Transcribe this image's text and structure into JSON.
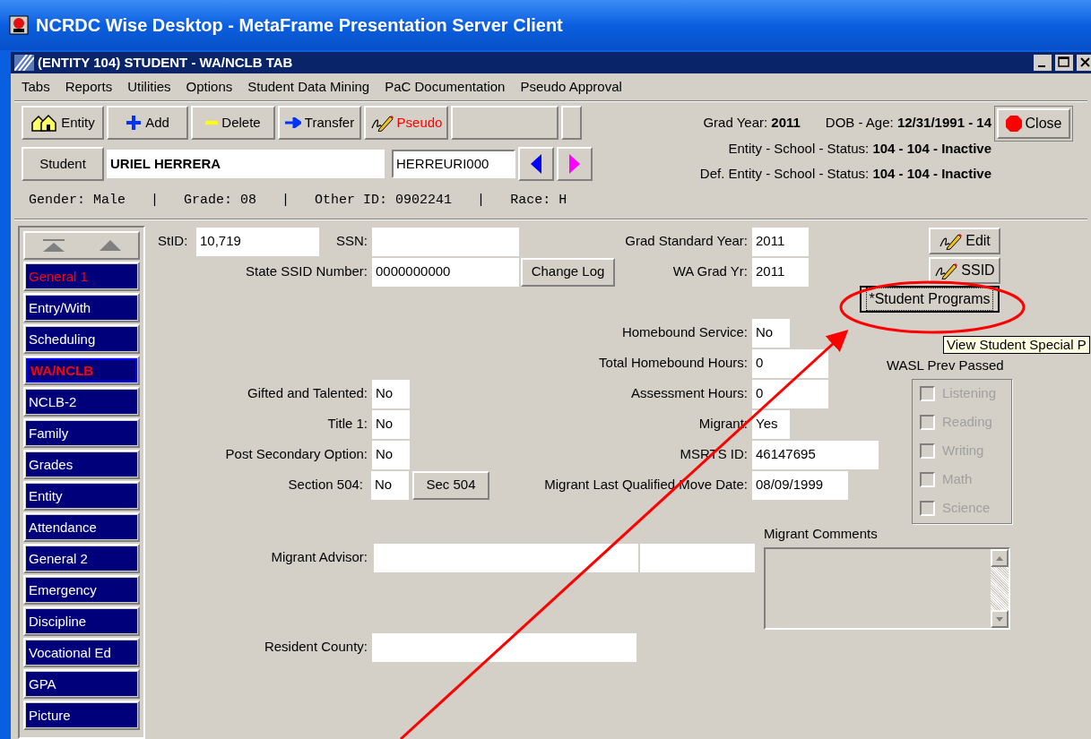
{
  "app_title": "NCRDC Wise Desktop - MetaFrame Presentation Server Client",
  "window": {
    "title": "(ENTITY 104) STUDENT - WA/NCLB TAB"
  },
  "menu": [
    "Tabs",
    "Reports",
    "Utilities",
    "Options",
    "Student Data Mining",
    "PaC Documentation",
    "Pseudo Approval"
  ],
  "toolbar": [
    {
      "label": "Entity",
      "kind": "entity"
    },
    {
      "label": "Add",
      "kind": "add"
    },
    {
      "label": "Delete",
      "kind": "delete"
    },
    {
      "label": "Transfer",
      "kind": "transfer"
    },
    {
      "label": "Pseudo",
      "kind": "pseudo"
    },
    {
      "kind": "blank_wide"
    },
    {
      "kind": "blank_narrow"
    }
  ],
  "student": {
    "button": "Student",
    "name": "URIEL HERRERA",
    "code": "HERREURI000"
  },
  "summary_lines": [
    [
      "Grad Year: **2011**",
      "DOB - Age: **12/31/1991 - 14**"
    ],
    [
      "Entity - School - Status: **104 - 104 - Inactive**"
    ],
    [
      "Def. Entity - School - Status: **104 - 104 - Inactive**"
    ]
  ],
  "close_button": "Close",
  "info_line": [
    "Gender: Male",
    "|",
    "Grade: 08",
    "|",
    "Other ID: 0902241",
    "|",
    "Race: H"
  ],
  "nav": [
    {
      "label": "General 1",
      "selected": false,
      "highlighted": true
    },
    {
      "label": "Entry/With",
      "selected": false,
      "highlighted": false
    },
    {
      "label": "Scheduling",
      "selected": false,
      "highlighted": false
    },
    {
      "label": "WA/NCLB",
      "selected": true,
      "highlighted": true
    },
    {
      "label": "NCLB-2",
      "selected": false,
      "highlighted": false
    },
    {
      "label": "Family",
      "selected": false,
      "highlighted": false
    },
    {
      "label": "Grades",
      "selected": false,
      "highlighted": false
    },
    {
      "label": "Entity",
      "selected": false,
      "highlighted": false
    },
    {
      "label": "Attendance",
      "selected": false,
      "highlighted": false
    },
    {
      "label": "General 2",
      "selected": false,
      "highlighted": false
    },
    {
      "label": "Emergency",
      "selected": false,
      "highlighted": false
    },
    {
      "label": "Discipline",
      "selected": false,
      "highlighted": false
    },
    {
      "label": "Vocational Ed",
      "selected": false,
      "highlighted": false
    },
    {
      "label": "GPA",
      "selected": false,
      "highlighted": false
    },
    {
      "label": "Picture",
      "selected": false,
      "highlighted": false
    }
  ],
  "form": {
    "stid": {
      "label": "StID:",
      "value": "10,719"
    },
    "ssn": {
      "label": "SSN:"
    },
    "state_ssid": {
      "label": "State SSID Number:",
      "value": "0000000000"
    },
    "change_log": "Change Log",
    "grad_standard_year": {
      "label": "Grad Standard Year:",
      "value": "2011"
    },
    "wa_grad_yr": {
      "label": "WA Grad Yr:",
      "value": "2011"
    },
    "edit_button": "Edit",
    "ssid_button": "SSID",
    "programs_button": "*Student Programs",
    "tooltip": "View Student Special P",
    "homebound_service": {
      "label": "Homebound Service:",
      "value": "No"
    },
    "total_homebound_hours": {
      "label": "Total Homebound Hours:",
      "value": "0"
    },
    "gifted": {
      "label": "Gifted and Talented:",
      "value": "No"
    },
    "assessment_hours": {
      "label": "Assessment Hours:",
      "value": "0"
    },
    "title1": {
      "label": "Title 1:",
      "value": "No"
    },
    "migrant": {
      "label": "Migrant:",
      "value": "Yes"
    },
    "post_secondary": {
      "label": "Post Secondary Option:",
      "value": "No"
    },
    "msrts": {
      "label": "MSRTS ID:",
      "value": "46147695"
    },
    "section504": {
      "label": "Section 504:",
      "value": "No"
    },
    "sec504_button": "Sec 504",
    "move_date": {
      "label": "Migrant Last Qualified Move Date:",
      "value": "08/09/1999"
    },
    "wasl": {
      "title": "WASL Prev Passed",
      "items": [
        {
          "label": "Listening",
          "checked": false,
          "disabled": true
        },
        {
          "label": "Reading",
          "checked": false,
          "disabled": true
        },
        {
          "label": "Writing",
          "checked": false,
          "disabled": true
        },
        {
          "label": "Math",
          "checked": false,
          "disabled": true
        },
        {
          "label": "Science",
          "checked": false,
          "disabled": true
        }
      ]
    },
    "migrant_comments": {
      "label": "Migrant Comments"
    },
    "migrant_advisor": {
      "label": "Migrant Advisor:"
    },
    "resident_county": {
      "label": "Resident County:"
    }
  }
}
